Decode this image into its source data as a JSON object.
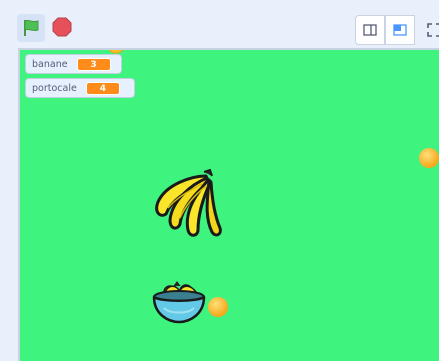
{
  "toolbar": {
    "icons": [
      "green-flag-icon",
      "stop-icon",
      "small-stage-icon",
      "normal-stage-icon",
      "fullscreen-icon"
    ]
  },
  "variables": [
    {
      "label": "banane",
      "value": "3"
    },
    {
      "label": "portocale",
      "value": "4"
    }
  ],
  "colors": {
    "stage": "#3ef47f",
    "monitor_value": "#ff8c1a",
    "flag": "#4cbf56",
    "stop": "#e6505a"
  }
}
